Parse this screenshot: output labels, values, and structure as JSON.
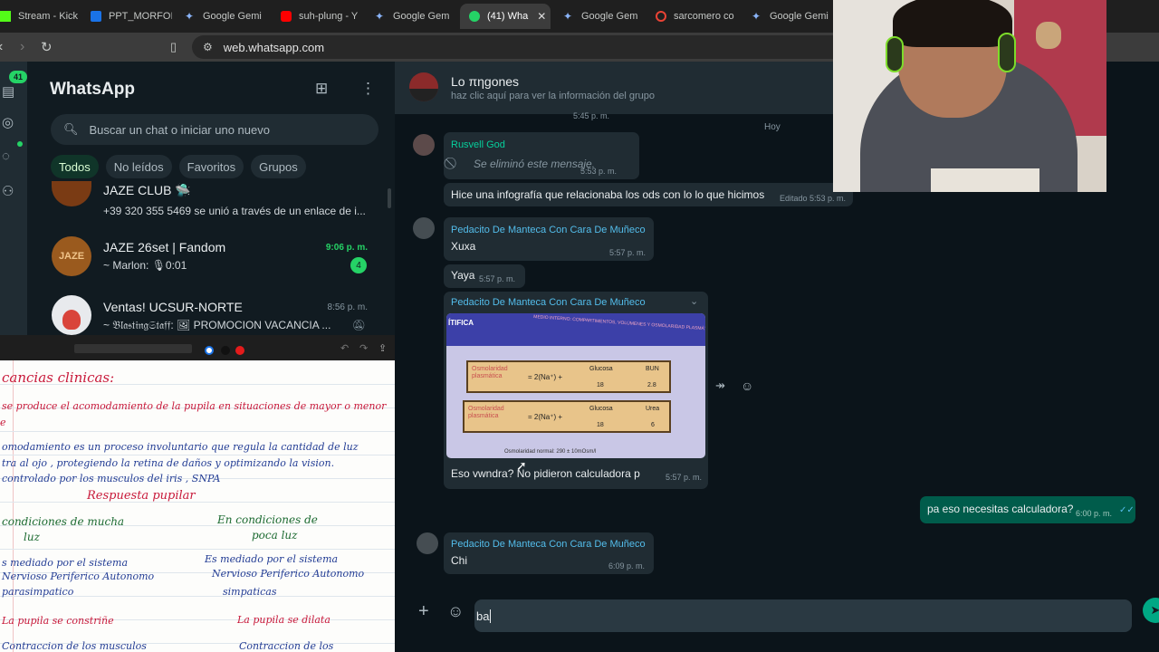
{
  "browser": {
    "tabs": [
      {
        "label": "Stream - Kick",
        "icon": "kick-icon"
      },
      {
        "label": "PPT_MORFOI",
        "icon": "powerpoint-icon"
      },
      {
        "label": "Google Gemi",
        "icon": "gemini-icon"
      },
      {
        "label": "suh-plung - Y",
        "icon": "youtube-icon"
      },
      {
        "label": "Google Gem",
        "icon": "gemini-icon"
      },
      {
        "label": "(41) Wha",
        "icon": "whatsapp-icon",
        "active": true
      },
      {
        "label": "Google Gem",
        "icon": "gemini-icon"
      },
      {
        "label": "sarcomero co",
        "icon": "google-icon"
      },
      {
        "label": "Google Gemi",
        "icon": "gemini-icon"
      }
    ],
    "url": "web.whatsapp.com"
  },
  "sidebar": {
    "badge": "41",
    "title": "WhatsApp",
    "search_placeholder": "Buscar un chat o iniciar uno nuevo",
    "filters": [
      "Todos",
      "No leídos",
      "Favoritos",
      "Grupos"
    ],
    "chats": [
      {
        "name": "JAZE CLUB 🛸",
        "preview": "+39 320 355 5469 se unió a través de un enlace de i...",
        "time": "",
        "unread": ""
      },
      {
        "name": "JAZE 26set | Fandom",
        "preview": "~ Marlon: 🎙0:01",
        "time": "9:06 p. m.",
        "unread": "4"
      },
      {
        "name": "Ventas! UCSUR-NORTE",
        "preview": "~ 𝔅𝔩𝔞𝔰𝔱𝔦𝔫𝔤𝔖𝔱𝔞𝔣𝔣: 🖼 PROMOCION VACANCIA ...",
        "time": "8:56 p. m.",
        "unread": ""
      }
    ]
  },
  "notes": {
    "lines": [
      {
        "text": "cancias   clinicas:",
        "color": "red"
      },
      {
        "text": "se produce  el acomodamiento de la pupila  en situaciones de mayor o menor",
        "color": "red"
      },
      {
        "text": "e",
        "color": "red"
      },
      {
        "text": "omodamiento es un proceso involuntario que regula la cantidad de luz",
        "color": "blue"
      },
      {
        "text": "tra al ojo , protegiendo la retina de daños y optimizando la vision.",
        "color": "blue"
      },
      {
        "text": "controlado por los musculos del iris , SNPA",
        "color": "blue"
      },
      {
        "text": "Respuesta  pupilar",
        "color": "red"
      },
      {
        "text": "condiciones de mucha",
        "color": "green"
      },
      {
        "text": "En  condiciones  de",
        "color": "green"
      },
      {
        "text": "luz",
        "color": "green"
      },
      {
        "text": "poca luz",
        "color": "green"
      },
      {
        "text": "s mediado por el sistema",
        "color": "blue"
      },
      {
        "text": "Es mediado por el sistema",
        "color": "blue"
      },
      {
        "text": "Nervioso  Periferico  Autonomo",
        "color": "blue"
      },
      {
        "text": "Nervioso  Periferico  Autonomo",
        "color": "blue"
      },
      {
        "text": "parasimpatico",
        "color": "blue"
      },
      {
        "text": "simpaticas",
        "color": "blue"
      },
      {
        "text": "La pupila se constriñe",
        "color": "red"
      },
      {
        "text": "La pupila se dilata",
        "color": "red"
      },
      {
        "text": "Contraccion de los musculos",
        "color": "blue"
      },
      {
        "text": "Contraccion de los",
        "color": "blue"
      }
    ]
  },
  "chat": {
    "name": "Lo πηgones",
    "subtitle": "haz clic aquí para ver la información del grupo",
    "top_time": "5:45 p. m.",
    "date": "Hoy",
    "messages": [
      {
        "sender": "Rusvell God",
        "text": "Se eliminó este mensaje.",
        "time": "5:53 p. m."
      },
      {
        "text": "Hice una infografía que relacionaba los ods con lo lo que hicimos",
        "time": "Editado 5:53 p. m."
      },
      {
        "sender": "Pedacito De Manteca Con Cara De Muñeco",
        "text": "Xuxa",
        "time": "5:57 p. m."
      },
      {
        "text": "Yaya",
        "time": "5:57 p. m."
      },
      {
        "sender": "Pedacito De Manteca Con Cara De Muñeco",
        "text": "Eso vwndra? No pidieron calculadora p",
        "time": "5:57 p. m."
      },
      {
        "text": "pa eso necesitas calculadora?",
        "time": "6:00 p. m."
      },
      {
        "sender": "Pedacito De Manteca Con Cara De Muñeco",
        "text": "Chi",
        "time": "6:09 p. m."
      }
    ],
    "image": {
      "header": "ÍTIFICA",
      "banner": "MEDIO INTERNO: COMPARTIMENTOS, VOLÚMENES Y OSMOLARIDAD PLASMÁTICA",
      "formula1": {
        "label": "Osmolaridad plasmática",
        "eq": "= 2(Na⁺) +",
        "term": "Glucosa",
        "den": "18",
        "term2": "BUN",
        "den2": "2.8"
      },
      "formula2": {
        "label": "Osmolaridad plasmática",
        "eq": "= 2(Na⁺) +",
        "term": "Glucosa",
        "den": "18",
        "term2": "Urea",
        "den2": "6"
      },
      "footer": "Osmolaridad normal: 290 ± 10mOsm/l"
    },
    "input_value": "ba"
  }
}
